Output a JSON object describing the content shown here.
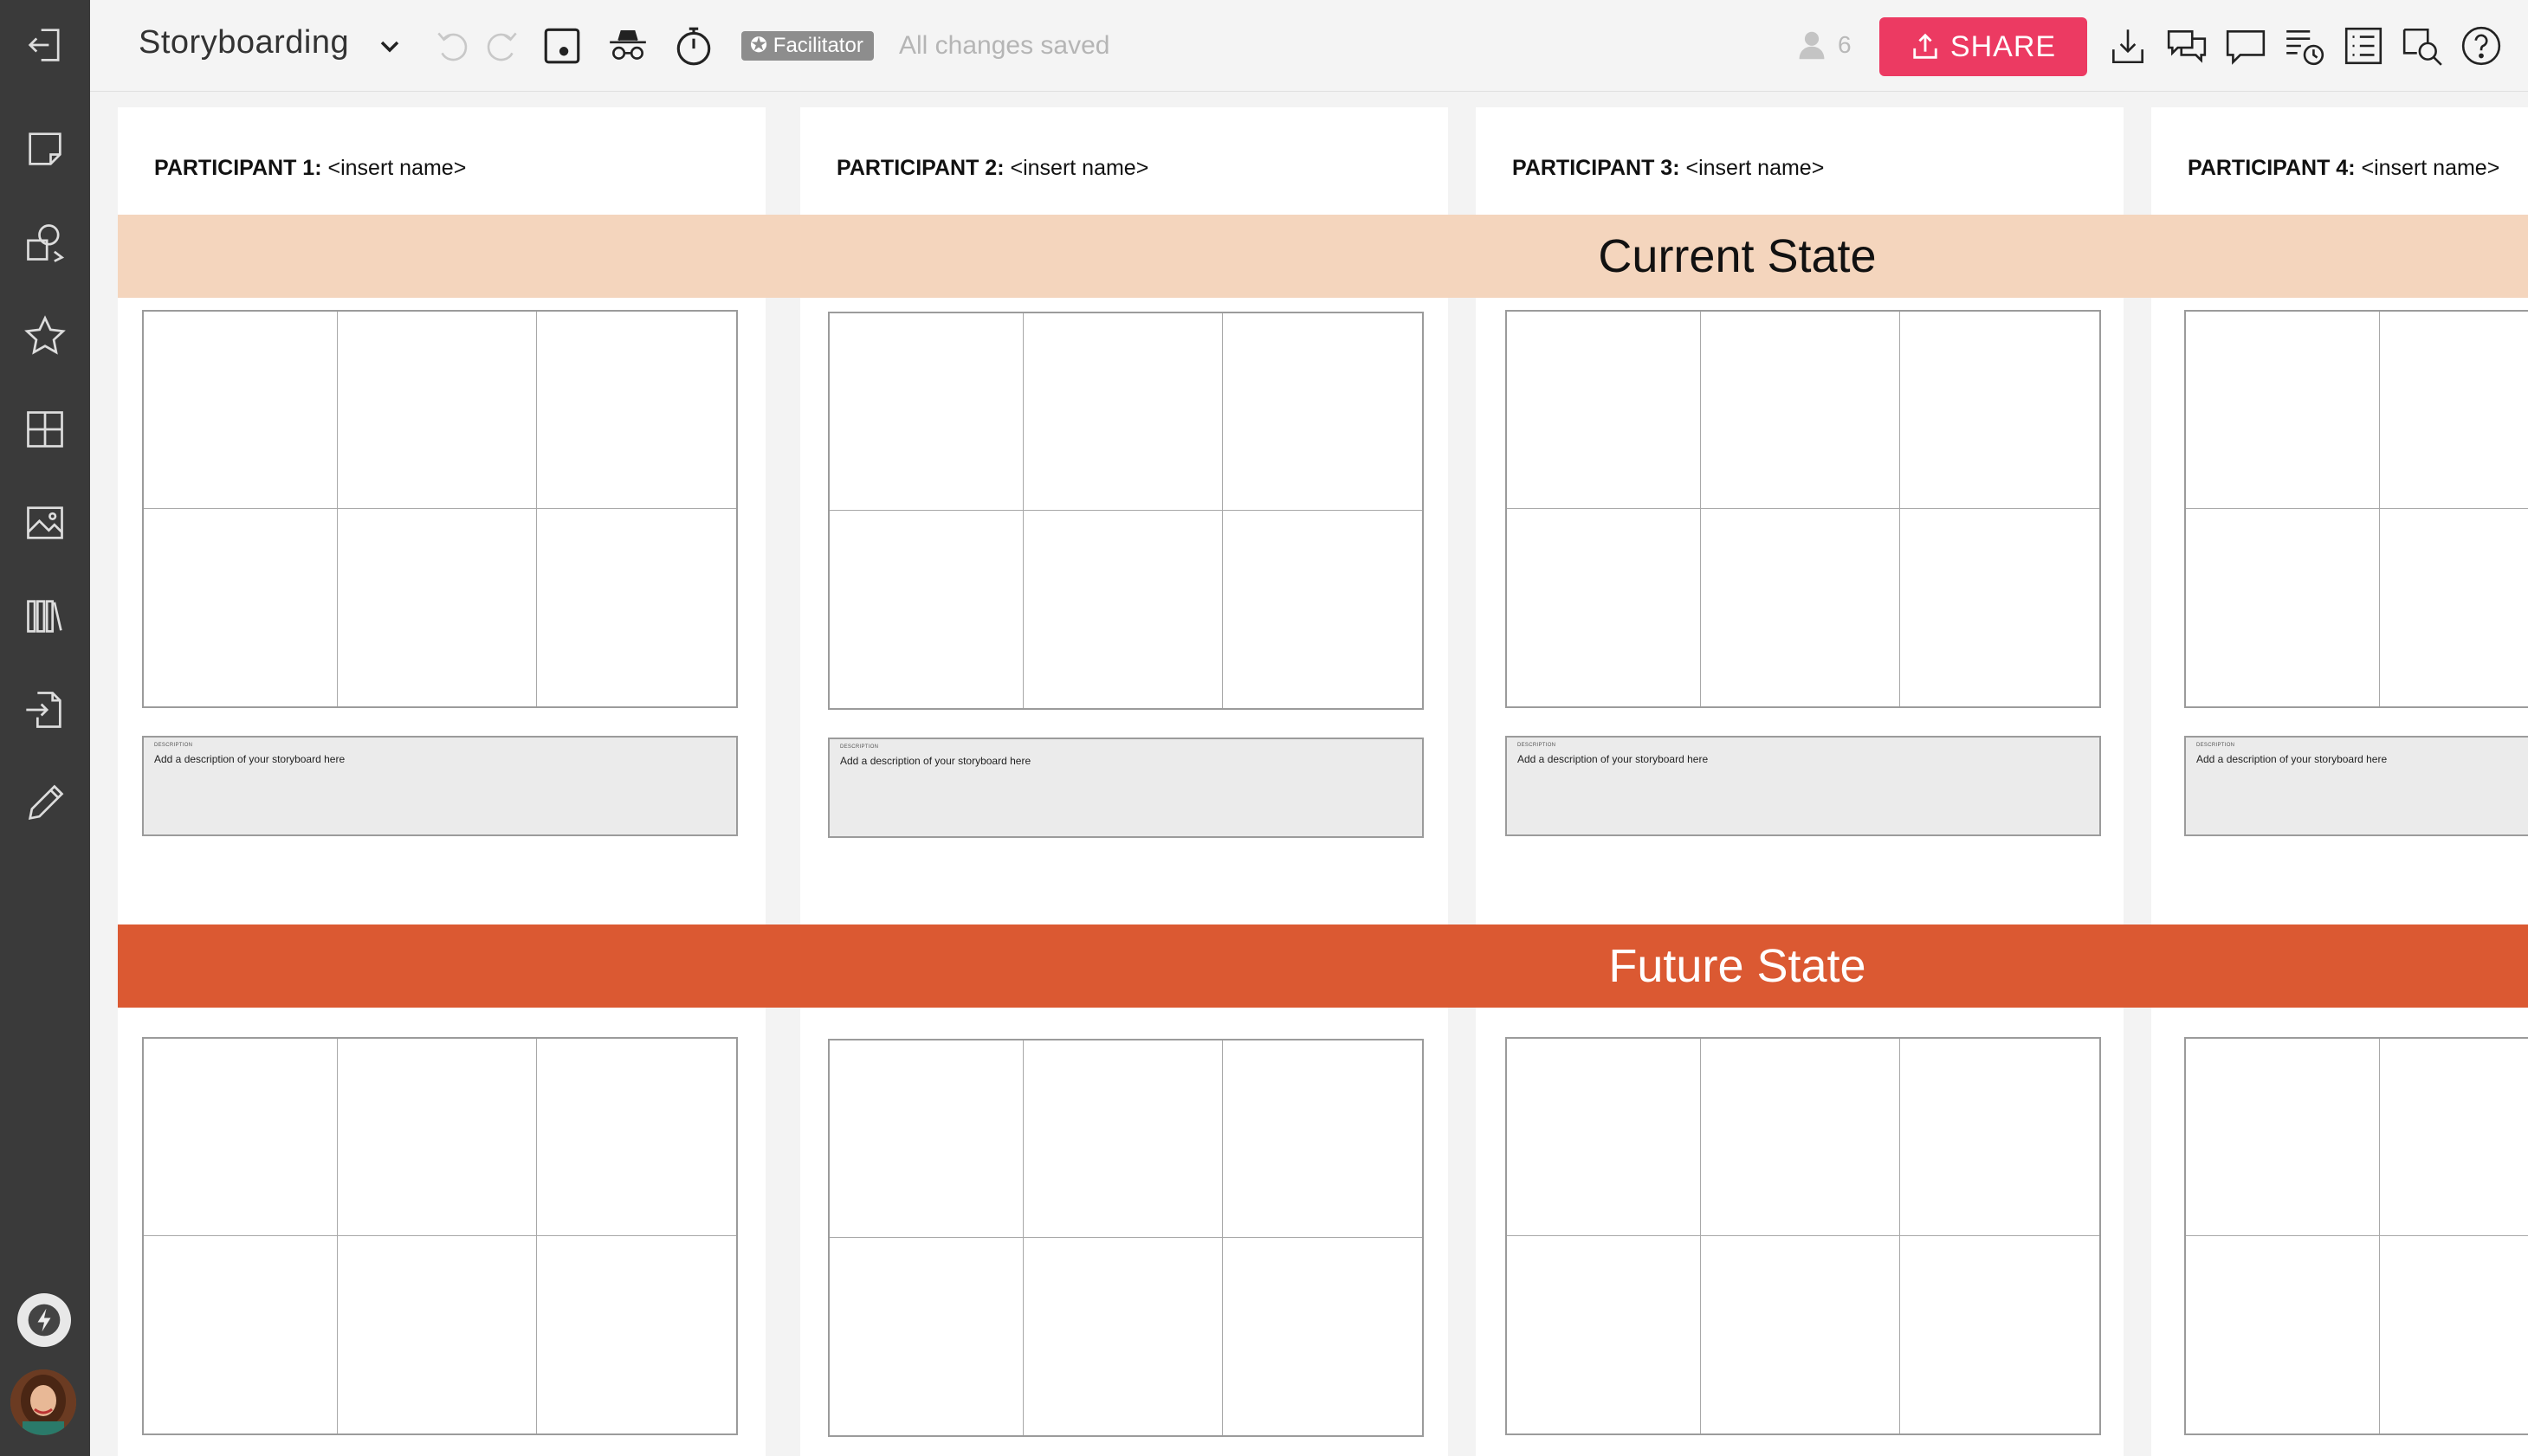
{
  "toolbar": {
    "board_title": "Storyboarding",
    "facilitator_label": "Facilitator",
    "save_status": "All changes saved",
    "user_count": "6",
    "share_label": "SHARE"
  },
  "sidebar": {
    "items": [
      "exit",
      "sticky-note",
      "shapes",
      "star",
      "grid",
      "image",
      "library",
      "import",
      "pen"
    ]
  },
  "participants": [
    {
      "label": "PARTICIPANT 1:",
      "name": "<insert name>"
    },
    {
      "label": "PARTICIPANT 2:",
      "name": "<insert name>"
    },
    {
      "label": "PARTICIPANT 3:",
      "name": "<insert name>"
    },
    {
      "label": "PARTICIPANT 4:",
      "name": "<insert name>"
    }
  ],
  "sections": {
    "current": "Current State",
    "future": "Future State"
  },
  "description": {
    "label": "DESCRIPTION",
    "placeholder": "Add a description of your storyboard here"
  },
  "colors": {
    "accent": "#ec3a62",
    "current_band": "#f4d5bd",
    "future_band": "#db5932",
    "sidebar": "#3a3a3a"
  }
}
